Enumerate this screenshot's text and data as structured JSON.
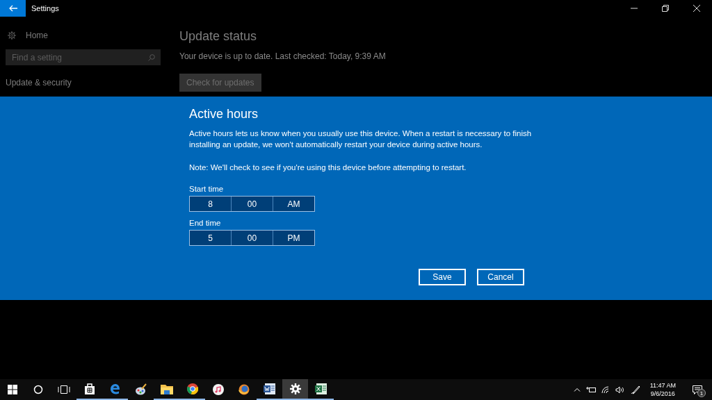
{
  "window": {
    "title": "Settings"
  },
  "sidebar": {
    "home": "Home",
    "search": {
      "placeholder": "Find a setting"
    },
    "section": "Update & security"
  },
  "main": {
    "heading": "Update status",
    "status": "Your device is up to date. Last checked: Today, 9:39 AM",
    "button": "Check for updates"
  },
  "dialog": {
    "title": "Active hours",
    "description": "Active hours lets us know when you usually use this device. When a restart is necessary to finish installing an update, we won't automatically restart your device during active hours.",
    "note": "Note: We'll check to see if you're using this device before attempting to restart.",
    "times": [
      {
        "label": "Start time",
        "hour": "8",
        "minute": "00",
        "period": "AM"
      },
      {
        "label": "End time",
        "hour": "5",
        "minute": "00",
        "period": "PM"
      }
    ],
    "buttons": [
      "Save",
      "Cancel"
    ]
  },
  "taskbar": {
    "apps": [
      {
        "kind": "start",
        "running": false,
        "selected": false
      },
      {
        "kind": "search",
        "running": false,
        "selected": false
      },
      {
        "kind": "taskview",
        "running": false,
        "selected": false
      },
      {
        "kind": "store",
        "running": true,
        "selected": false
      },
      {
        "kind": "edge",
        "running": true,
        "selected": false
      },
      {
        "kind": "paint",
        "running": false,
        "selected": false
      },
      {
        "kind": "folder",
        "running": true,
        "selected": false
      },
      {
        "kind": "chrome",
        "running": true,
        "selected": false
      },
      {
        "kind": "music",
        "running": false,
        "selected": false
      },
      {
        "kind": "firefox",
        "running": false,
        "selected": false
      },
      {
        "kind": "word",
        "running": true,
        "selected": false
      },
      {
        "kind": "settings",
        "running": true,
        "selected": true
      },
      {
        "kind": "excel",
        "running": true,
        "selected": false
      }
    ],
    "time": "11:47 AM",
    "date": "9/6/2016",
    "notifications": "1"
  }
}
